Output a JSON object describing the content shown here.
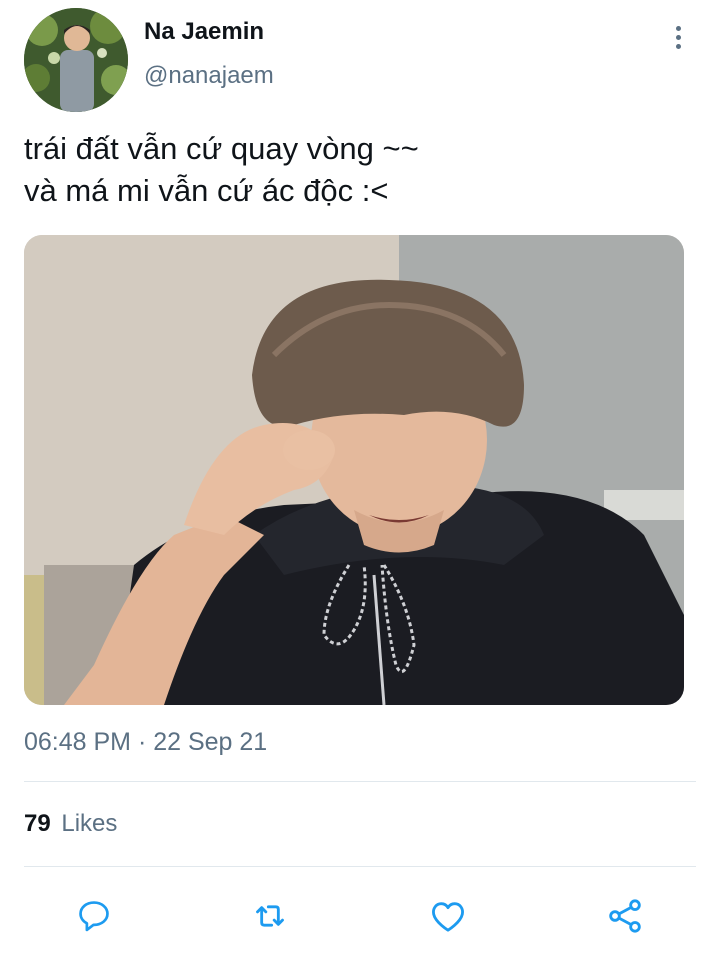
{
  "author": {
    "name": "Na Jaemin",
    "handle": "@nanajaem",
    "avatar": "profile-photo"
  },
  "tweet": {
    "lines": [
      "trái đất vẫn cứ quay vòng ~~",
      "và má mi vẫn cứ ác độc :<"
    ],
    "media": "photo-person-crying"
  },
  "meta": {
    "timestamp": "06:48 PM · 22 Sep 21"
  },
  "stats": {
    "likes_count": "79",
    "likes_label": "Likes"
  },
  "actions": {
    "icons": [
      "reply-icon",
      "retweet-icon",
      "like-icon",
      "share-icon"
    ]
  },
  "colors": {
    "text_primary": "#0f1419",
    "text_secondary": "#5b7083",
    "icon": "#1d9bf0",
    "divider": "#e1e8ed"
  }
}
